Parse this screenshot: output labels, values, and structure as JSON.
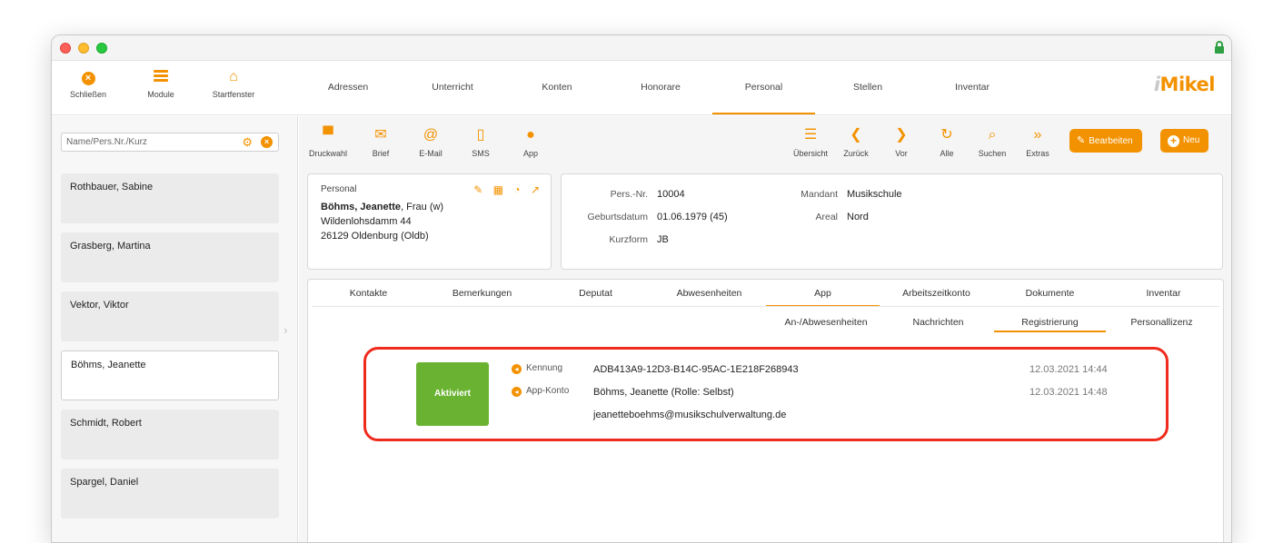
{
  "toolbar": {
    "close": "Schließen",
    "modules": "Module",
    "start": "Startfenster"
  },
  "nav": [
    "Adressen",
    "Unterricht",
    "Konten",
    "Honorare",
    "Personal",
    "Stellen",
    "Inventar"
  ],
  "nav_active": "Personal",
  "logo": {
    "i": "i",
    "rest": "Mikel"
  },
  "search": {
    "placeholder": "Name/Pers.Nr./Kurz"
  },
  "persons": [
    "Rothbauer, Sabine",
    "Grasberg, Martina",
    "Vektor, Viktor",
    "Böhms, Jeanette",
    "Schmidt, Robert",
    "Spargel, Daniel"
  ],
  "selected_person": "Böhms, Jeanette",
  "actions": {
    "print": "Druckwahl",
    "letter": "Brief",
    "email": "E-Mail",
    "sms": "SMS",
    "app": "App",
    "overview": "Übersicht",
    "back": "Zurück",
    "forward": "Vor",
    "all": "Alle",
    "search": "Suchen",
    "extras": "Extras",
    "edit": "Bearbeiten",
    "new": "Neu"
  },
  "personal": {
    "label": "Personal",
    "name": "Böhms, Jeanette",
    "salutation": ", Frau (w)",
    "street": "Wildenlohsdamm 44",
    "city": "26129 Oldenburg (Oldb)"
  },
  "info": {
    "pers_nr_label": "Pers.-Nr.",
    "pers_nr": "10004",
    "birth_label": "Geburtsdatum",
    "birth": "01.06.1979 (45)",
    "short_label": "Kurzform",
    "short": "JB",
    "client_label": "Mandant",
    "client": "Musikschule",
    "area_label": "Areal",
    "area": "Nord"
  },
  "tabs": [
    "Kontakte",
    "Bemerkungen",
    "Deputat",
    "Abwesenheiten",
    "App",
    "Arbeitszeitkonto",
    "Dokumente",
    "Inventar"
  ],
  "tab_active": "App",
  "subtabs": [
    "An-/Abwesenheiten",
    "Nachrichten",
    "Registrierung",
    "Personallizenz"
  ],
  "subtab_active": "Registrierung",
  "registration": {
    "status": "Aktiviert",
    "status_color": "#6ab332",
    "id_label": "Kennung",
    "id_value": "ADB413A9-12D3-B14C-95AC-1E218F268943",
    "id_date": "12.03.2021 14:44",
    "account_label": "App-Konto",
    "account_value": "Böhms, Jeanette (Rolle: Selbst)",
    "account_date": "12.03.2021 14:48",
    "email": "jeanetteboehms@musikschulverwaltung.de"
  },
  "colors": {
    "accent": "#f39200",
    "highlight": "#ef2b1d"
  }
}
